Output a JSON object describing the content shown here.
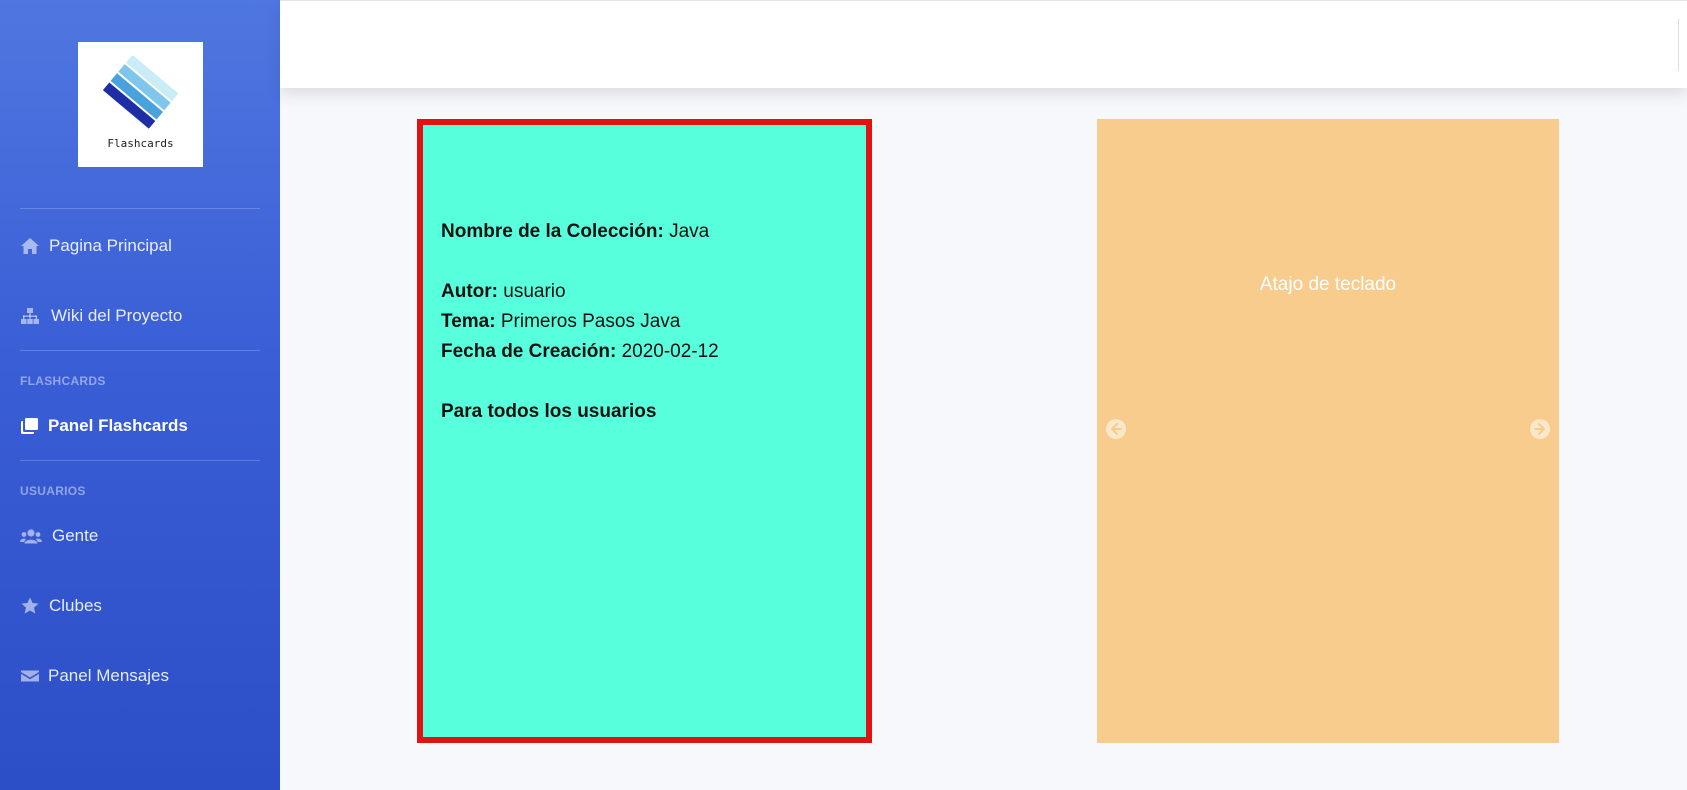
{
  "brand": {
    "logo_text": "Flashcards"
  },
  "sidebar": {
    "items": [
      {
        "label": "Pagina Principal",
        "icon": "home-icon"
      },
      {
        "label": "Wiki del Proyecto",
        "icon": "sitemap-icon"
      }
    ],
    "sections": [
      {
        "heading": "FLASHCARDS",
        "items": [
          {
            "label": "Panel Flashcards",
            "icon": "copy-icon",
            "active": true
          }
        ]
      },
      {
        "heading": "USUARIOS",
        "items": [
          {
            "label": "Gente",
            "icon": "users-icon"
          },
          {
            "label": "Clubes",
            "icon": "star-icon"
          },
          {
            "label": "Panel Mensajes",
            "icon": "envelope-icon"
          }
        ]
      }
    ]
  },
  "card": {
    "name_label": "Nombre de la Colección:",
    "name_value": "Java",
    "author_label": "Autor:",
    "author_value": "usuario",
    "topic_label": "Tema:",
    "topic_value": "Primeros Pasos Java",
    "date_label": "Fecha de Creación:",
    "date_value": "2020-02-12",
    "visibility": "Para todos los usuarios",
    "background_color": "#58ffdd",
    "border_color": "#e31212"
  },
  "carousel": {
    "caption": "Atajo de teclado",
    "background_color": "#f7cc8c",
    "prev_icon": "arrow-circle-left-icon",
    "next_icon": "arrow-circle-right-icon"
  },
  "colors": {
    "sidebar_top": "#4f77e0",
    "sidebar_bottom": "#2c4ec7"
  }
}
